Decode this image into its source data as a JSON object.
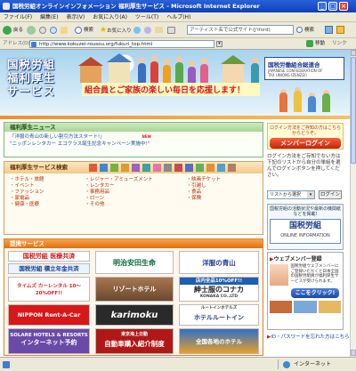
{
  "window": {
    "title": "国税労組オンラインインフォメーション 福利厚生サービス - Microsoft Internet Explorer",
    "minimize": "_",
    "maximize": "□",
    "close": "×"
  },
  "menu": [
    "ファイル(F)",
    "編集(E)",
    "表示(V)",
    "お気に入り(A)",
    "ツール(T)",
    "ヘルプ(H)"
  ],
  "toolbar": {
    "back": "戻る",
    "search": "検索",
    "favorites": "お気に入り",
    "search_field": "アーティスト名で公式サイト(J'iford)",
    "search_btn": "検索"
  },
  "address": {
    "label": "アドレス(D)",
    "url": "http://www.kokuzei-rousou.org/fukuri_top.html",
    "go": "移動",
    "links": "リンク"
  },
  "banner": {
    "logo_line1": "国税労組",
    "logo_line2": "福利厚生",
    "logo_line3": "サービス",
    "slogan": "組合員とご家族の楽しい毎日を応援します！",
    "assoc_name": "国税労働組合総連合",
    "assoc_en1": "JAPANESE CONFEDERATION OF",
    "assoc_en2": "TAX UNIONS (ZENZEI)"
  },
  "news": {
    "title": "福利厚生ニュース",
    "items": [
      "「洋服の青山の新しい割引方法スタート!」",
      "\"ニッポンレンタカー エコクラス誕生記念キャンペーン実施中!\""
    ],
    "new_badge": "NEW"
  },
  "search": {
    "title": "福利厚生サービス検索",
    "col1": [
      "・ホテル・旅館",
      "・イベント",
      "・ファッション",
      "・家電品",
      "・健康・医療"
    ],
    "col2": [
      "・レジャー・アミューズメント",
      "・レンタカー",
      "・事務用品",
      "・ローン",
      "・その他"
    ],
    "col3": [
      "・映画チケット",
      "・引越し",
      "・食品",
      "・保険"
    ]
  },
  "sidebar": {
    "login_note": "ログイン方法をご存知の方はこちらからどうぞ。",
    "member_login": "メンバーログイン",
    "login_desc": "ログイン方法をご存知でない方は下記のリストから自分の単組を選んでログインボタンを押してください。",
    "select_label": "リストから選択",
    "login_btn": "ログイン",
    "info_title": "国税労組の活動状況や最新の機関紙などを掲載!",
    "online_info_name": "国税労組",
    "online_info_en": "ONLINE INFORMATION",
    "web_member": "ウェブメンバー登録",
    "web_member_desc": "国税労組ウェブメンバーにご登録いただくと日本全国の国税労組員が福利厚生サービスが受けられます。",
    "register_btn": "ここをクリック!",
    "pw_link": "ID・パスワードを忘れた方はこちら"
  },
  "teikei": {
    "title": "提携サービス",
    "ads": [
      "国税労組 医療共済",
      "明治安田生命",
      "国税労組 積立年金共済",
      "洋服の青山",
      "タイムズ カーレンタル 10〜20%OFF!!",
      "リゾートホテル",
      "紳士服のコナカ",
      "NIPPON Rent-A-Car",
      "karimoku",
      "ホテルルートイン",
      "インターネット予約",
      "自動車購入紹介制度",
      "SOLARE HOTELS & RESORTS",
      "東京海上日動",
      "全国各地のホテル"
    ],
    "ad_sub": {
      "konaka_top": "店内全品10%OFF!!",
      "konaka_en": "KONAKA CO.,LTD",
      "routeinn_top": "ルートインホテルズ",
      "meiji_top": "明治安田生命"
    }
  },
  "status": {
    "left": "",
    "zone": "インターネット"
  }
}
